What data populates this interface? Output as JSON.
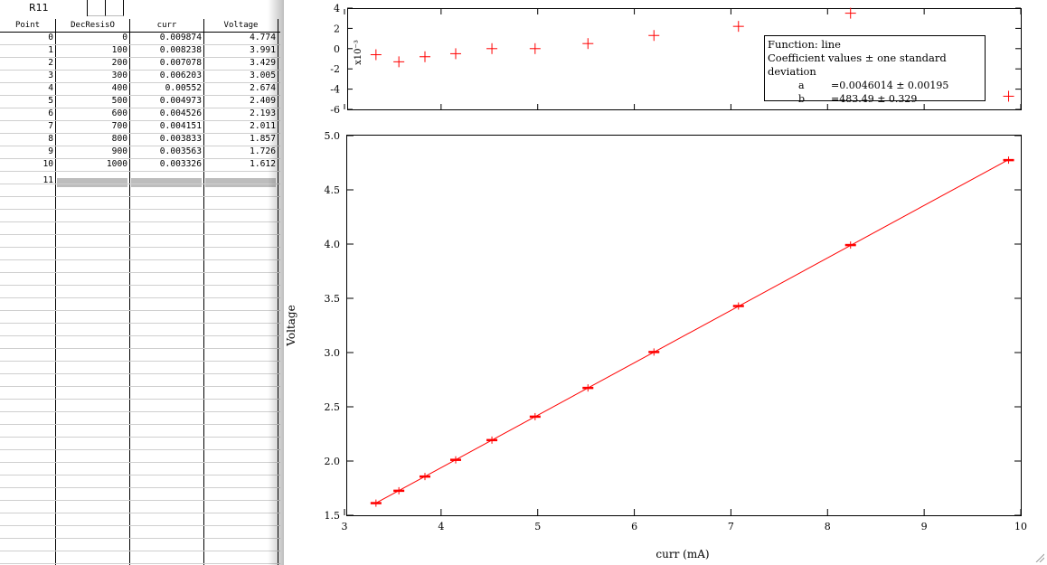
{
  "table": {
    "cell_name": "R11",
    "columns": [
      "Point",
      "DecResisO",
      "curr",
      "Voltage"
    ],
    "rows": [
      [
        "0",
        "0",
        "0.009874",
        "4.774"
      ],
      [
        "1",
        "100",
        "0.008238",
        "3.991"
      ],
      [
        "2",
        "200",
        "0.007078",
        "3.429"
      ],
      [
        "3",
        "300",
        "0.006203",
        "3.005"
      ],
      [
        "4",
        "400",
        "0.00552",
        "2.674"
      ],
      [
        "5",
        "500",
        "0.004973",
        "2.409"
      ],
      [
        "6",
        "600",
        "0.004526",
        "2.193"
      ],
      [
        "7",
        "700",
        "0.004151",
        "2.011"
      ],
      [
        "8",
        "800",
        "0.003833",
        "1.857"
      ],
      [
        "9",
        "900",
        "0.003563",
        "1.726"
      ],
      [
        "10",
        "1000",
        "0.003326",
        "1.612"
      ]
    ],
    "next_point": "11"
  },
  "graph": {
    "fit_info": {
      "function": "Function: line",
      "header": "Coefficient values ± one standard deviation",
      "coefficients": [
        {
          "name": "a",
          "value": "=0.0046014 ± 0.00195"
        },
        {
          "name": "b",
          "value": "=483.49 ± 0.329"
        }
      ]
    }
  },
  "chart_data": [
    {
      "type": "scatter",
      "title": "",
      "xlabel": "curr (mA)",
      "ylabel": "Voltage",
      "xlim": [
        3,
        10
      ],
      "ylim": [
        1.5,
        5.0
      ],
      "x_ticks": [
        "3",
        "4",
        "5",
        "6",
        "7",
        "8",
        "9",
        "10"
      ],
      "y_ticks": [
        "1.5",
        "2.0",
        "2.5",
        "3.0",
        "3.5",
        "4.0",
        "4.5",
        "5.0"
      ],
      "marker": "cross",
      "color": "#ff0000",
      "x": [
        9.874,
        8.238,
        7.078,
        6.203,
        5.52,
        4.973,
        4.526,
        4.151,
        3.833,
        3.563,
        3.326
      ],
      "y": [
        4.774,
        3.991,
        3.429,
        3.005,
        2.674,
        2.409,
        2.193,
        2.011,
        1.857,
        1.726,
        1.612
      ],
      "fit_line": {
        "a": 0.0046014,
        "b": 483.49,
        "x_scale": 0.001
      }
    },
    {
      "type": "scatter",
      "role": "residuals",
      "ylabel": "x10⁻³",
      "ylim": [
        -6,
        4
      ],
      "y_ticks": [
        "-6",
        "-4",
        "-2",
        "0",
        "2",
        "4"
      ],
      "marker": "cross",
      "color": "#ff0000",
      "x": [
        9.874,
        8.238,
        7.078,
        6.203,
        5.52,
        4.973,
        4.526,
        4.151,
        3.833,
        3.563,
        3.326
      ],
      "residuals": [
        -4.7,
        3.5,
        2.2,
        1.3,
        0.5,
        0.0,
        0.0,
        -0.5,
        -0.8,
        -1.3,
        -0.6
      ]
    }
  ]
}
